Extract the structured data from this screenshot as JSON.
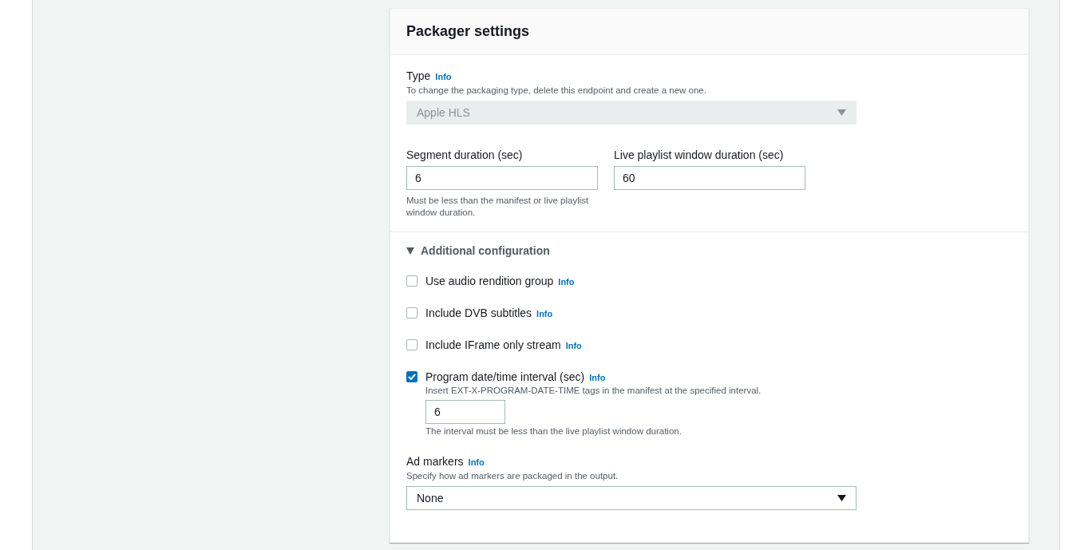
{
  "panel": {
    "title": "Packager settings"
  },
  "type_field": {
    "label": "Type",
    "info": "Info",
    "description": "To change the packaging type, delete this endpoint and create a new one.",
    "value": "Apple HLS",
    "disabled": true
  },
  "duration_fields": [
    {
      "label": "Segment duration (sec)",
      "value": "6",
      "hint": "Must be less than the manifest or live playlist window duration."
    },
    {
      "label": "Live playlist window duration (sec)",
      "value": "60"
    }
  ],
  "additional_configuration": {
    "title": "Additional configuration",
    "expanded": true,
    "options": [
      {
        "label": "Use audio rendition group",
        "info": "Info",
        "checked": false
      },
      {
        "label": "Include DVB subtitles",
        "info": "Info",
        "checked": false
      },
      {
        "label": "Include IFrame only stream",
        "info": "Info",
        "checked": false
      },
      {
        "label": "Program date/time interval (sec)",
        "info": "Info",
        "checked": true,
        "description": "Insert EXT-X-PROGRAM-DATE-TIME tags in the manifest at the specified interval.",
        "value": "6",
        "hint": "The interval must be less than the live playlist window duration."
      }
    ]
  },
  "ad_markers": {
    "label": "Ad markers",
    "info": "Info",
    "description": "Specify how ad markers are packaged in the output.",
    "value": "None",
    "disabled": false
  }
}
